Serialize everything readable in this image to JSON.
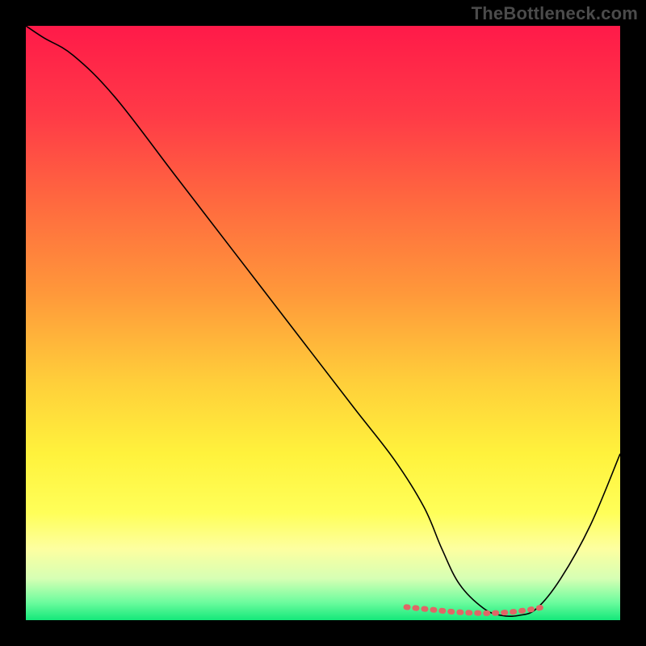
{
  "watermark": "TheBottleneck.com",
  "chart_data": {
    "type": "line",
    "title": "",
    "xlabel": "",
    "ylabel": "",
    "xlim": [
      0,
      100
    ],
    "ylim": [
      0,
      100
    ],
    "grid": false,
    "legend": false,
    "background_gradient": {
      "stops": [
        {
          "offset": 0.0,
          "color": "#ff1a49"
        },
        {
          "offset": 0.15,
          "color": "#ff3a47"
        },
        {
          "offset": 0.3,
          "color": "#ff6a3f"
        },
        {
          "offset": 0.45,
          "color": "#ff983a"
        },
        {
          "offset": 0.6,
          "color": "#ffcf3a"
        },
        {
          "offset": 0.72,
          "color": "#fff23c"
        },
        {
          "offset": 0.82,
          "color": "#ffff59"
        },
        {
          "offset": 0.88,
          "color": "#fdffa0"
        },
        {
          "offset": 0.93,
          "color": "#d6ffb4"
        },
        {
          "offset": 0.97,
          "color": "#6dfc9e"
        },
        {
          "offset": 1.0,
          "color": "#14e87a"
        }
      ]
    },
    "series": [
      {
        "name": "main-curve",
        "color": "#000000",
        "stroke_width": 1.6,
        "x": [
          0,
          3,
          8,
          15,
          25,
          35,
          45,
          55,
          62,
          67,
          70,
          73,
          77,
          80,
          83,
          86,
          90,
          95,
          100
        ],
        "values": [
          100,
          98,
          95,
          88,
          75,
          62,
          49,
          36,
          27,
          19,
          12,
          6,
          2,
          0.8,
          0.8,
          2,
          7,
          16,
          28
        ]
      },
      {
        "name": "highlight-band",
        "color": "#e06666",
        "stroke_width": 7,
        "x": [
          64,
          68,
          72,
          76,
          79,
          82,
          85,
          87
        ],
        "values": [
          2.2,
          1.8,
          1.4,
          1.2,
          1.2,
          1.4,
          1.8,
          2.2
        ]
      }
    ]
  }
}
